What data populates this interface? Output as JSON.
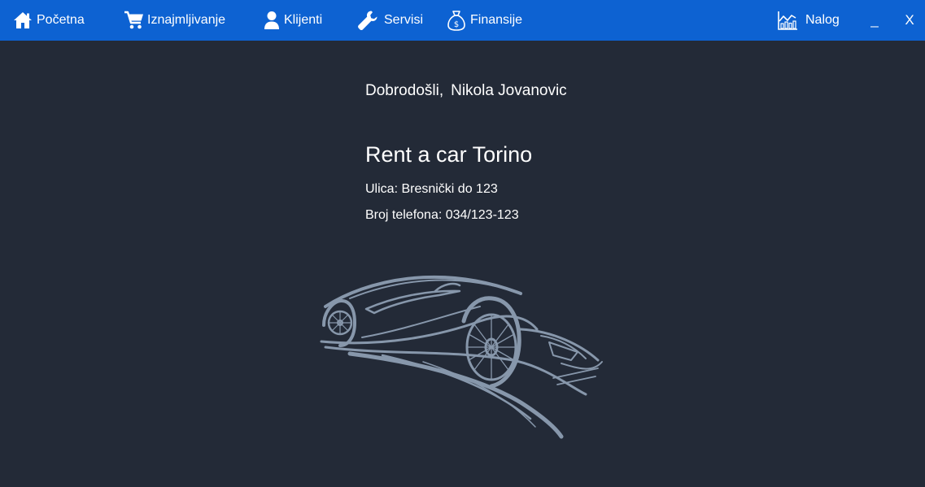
{
  "nav": {
    "items": [
      {
        "id": "pocetna",
        "label": "Početna",
        "icon": "home-icon"
      },
      {
        "id": "iznajmljivanje",
        "label": "Iznajmljivanje",
        "icon": "cart-icon"
      },
      {
        "id": "klijenti",
        "label": "Klijenti",
        "icon": "user-icon"
      },
      {
        "id": "servisi",
        "label": "Servisi",
        "icon": "wrench-icon"
      },
      {
        "id": "finansije",
        "label": "Finansije",
        "icon": "money-bag-icon"
      }
    ],
    "account": {
      "label": "Nalog",
      "icon": "chart-icon"
    }
  },
  "window": {
    "minimize_label": "_",
    "close_label": "X"
  },
  "main": {
    "welcome_label": "Dobrodošli,",
    "user_name": "Nikola Jovanovic",
    "company_name": "Rent a car Torino",
    "address": "Ulica: Bresnički do 123",
    "phone": "Broj telefona: 034/123-123"
  },
  "colors": {
    "topbar": "#0d62d2",
    "background": "#232a37",
    "logo": "#8797ab"
  }
}
